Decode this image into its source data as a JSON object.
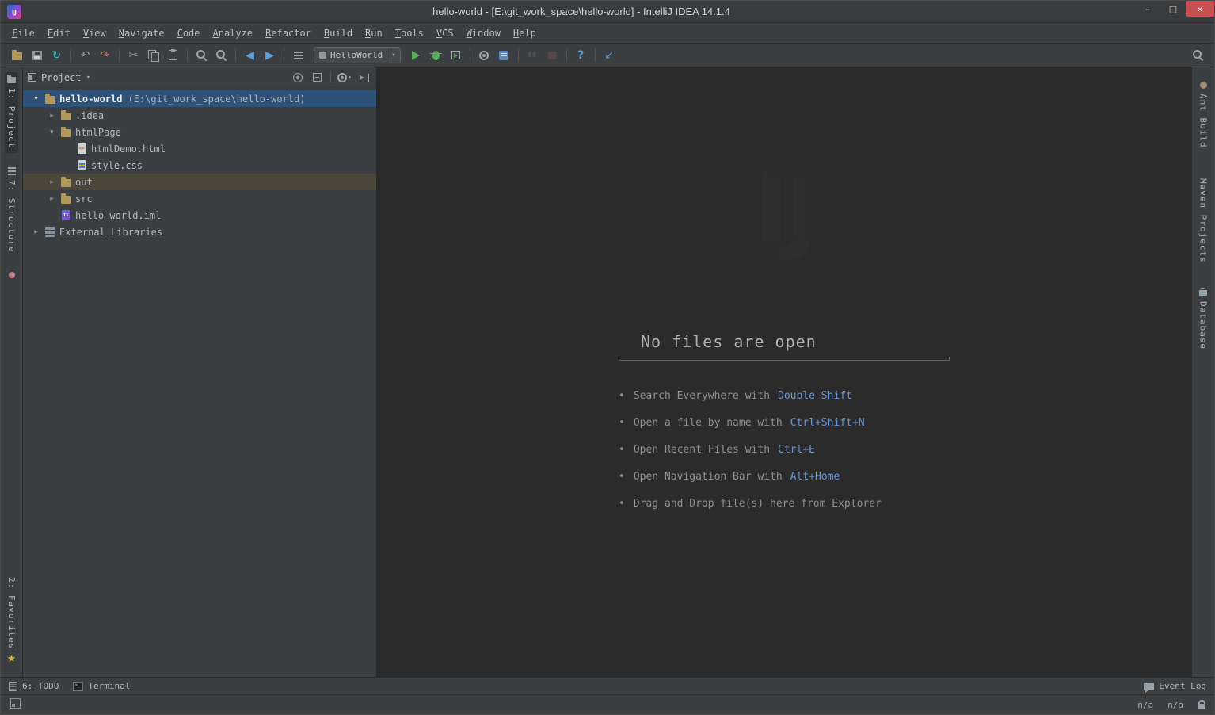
{
  "window": {
    "logo": "IJ",
    "title": "hello-world - [E:\\git_work_space\\hello-world] - IntelliJ IDEA 14.1.4",
    "controls": {
      "minimize": "–",
      "maximize": "□",
      "close": "×"
    }
  },
  "menu": [
    "File",
    "Edit",
    "View",
    "Navigate",
    "Code",
    "Analyze",
    "Refactor",
    "Build",
    "Run",
    "Tools",
    "VCS",
    "Window",
    "Help"
  ],
  "toolbar": {
    "run_config": "HelloWorld",
    "items": [
      {
        "t": "icon",
        "n": "open"
      },
      {
        "t": "icon",
        "n": "save"
      },
      {
        "t": "icon",
        "n": "sync"
      },
      {
        "t": "sep"
      },
      {
        "t": "icon",
        "n": "undo"
      },
      {
        "t": "icon",
        "n": "redo"
      },
      {
        "t": "sep"
      },
      {
        "t": "icon",
        "n": "cut"
      },
      {
        "t": "icon",
        "n": "copy"
      },
      {
        "t": "icon",
        "n": "paste"
      },
      {
        "t": "sep"
      },
      {
        "t": "icon",
        "n": "find"
      },
      {
        "t": "icon",
        "n": "replace"
      },
      {
        "t": "sep"
      },
      {
        "t": "icon",
        "n": "back"
      },
      {
        "t": "icon",
        "n": "forward"
      },
      {
        "t": "sep"
      },
      {
        "t": "icon",
        "n": "compile"
      },
      {
        "t": "combo"
      },
      {
        "t": "icon",
        "n": "run"
      },
      {
        "t": "icon",
        "n": "debug"
      },
      {
        "t": "icon",
        "n": "coverage"
      },
      {
        "t": "sep"
      },
      {
        "t": "icon",
        "n": "settings"
      },
      {
        "t": "icon",
        "n": "project-structure"
      },
      {
        "t": "sep"
      },
      {
        "t": "icon",
        "n": "pause",
        "disabled": true
      },
      {
        "t": "icon",
        "n": "stop",
        "disabled": true
      },
      {
        "t": "sep"
      },
      {
        "t": "icon",
        "n": "help"
      },
      {
        "t": "sep"
      },
      {
        "t": "icon",
        "n": "update-project"
      }
    ]
  },
  "left_bar": {
    "top": [
      {
        "label": "1: Project",
        "icon": "project",
        "active": true
      },
      {
        "label": "7: Structure",
        "icon": "structure"
      },
      {
        "label": "",
        "icon": "captures"
      }
    ],
    "bottom": [
      {
        "label": "2: Favorites",
        "icon": "star",
        "icon_after": true
      }
    ]
  },
  "right_bar": [
    {
      "label": "Ant Build",
      "icon": "ant"
    },
    {
      "label": "Maven Projects",
      "icon": "maven"
    },
    {
      "label": "Database",
      "icon": "database"
    }
  ],
  "project": {
    "header": "Project",
    "tree": [
      {
        "label": "hello-world",
        "path": "(E:\\git_work_space\\hello-world)",
        "level": 0,
        "state": "expanded",
        "icon": "project-folder",
        "selected": true,
        "bold": true
      },
      {
        "label": ".idea",
        "level": 1,
        "state": "collapsed",
        "icon": "folder"
      },
      {
        "label": "htmlPage",
        "level": 1,
        "state": "expanded",
        "icon": "folder"
      },
      {
        "label": "htmlDemo.html",
        "level": 2,
        "state": "none",
        "icon": "html"
      },
      {
        "label": "style.css",
        "level": 2,
        "state": "none",
        "icon": "css"
      },
      {
        "label": "out",
        "level": 1,
        "state": "collapsed",
        "icon": "folder",
        "highlight": true
      },
      {
        "label": "src",
        "level": 1,
        "state": "collapsed",
        "icon": "folder"
      },
      {
        "label": "hello-world.iml",
        "level": 1,
        "state": "none",
        "icon": "iml"
      },
      {
        "label": "External Libraries",
        "level": 0,
        "state": "collapsed",
        "icon": "library"
      }
    ]
  },
  "editor": {
    "watermark": "IJ",
    "title": "No files are open",
    "tips": [
      {
        "text": "Search Everywhere with",
        "shortcut": "Double Shift"
      },
      {
        "text": "Open a file by name with",
        "shortcut": "Ctrl+Shift+N"
      },
      {
        "text": "Open Recent Files with",
        "shortcut": "Ctrl+E"
      },
      {
        "text": "Open Navigation Bar with",
        "shortcut": "Alt+Home"
      },
      {
        "text": "Drag and Drop file(s) here from Explorer",
        "shortcut": ""
      }
    ]
  },
  "bottom_bar": {
    "todo": "6: TODO",
    "terminal": "Terminal",
    "event_log": "Event Log"
  },
  "status_bar": {
    "position": "n/a",
    "line_ending": "n/a"
  }
}
